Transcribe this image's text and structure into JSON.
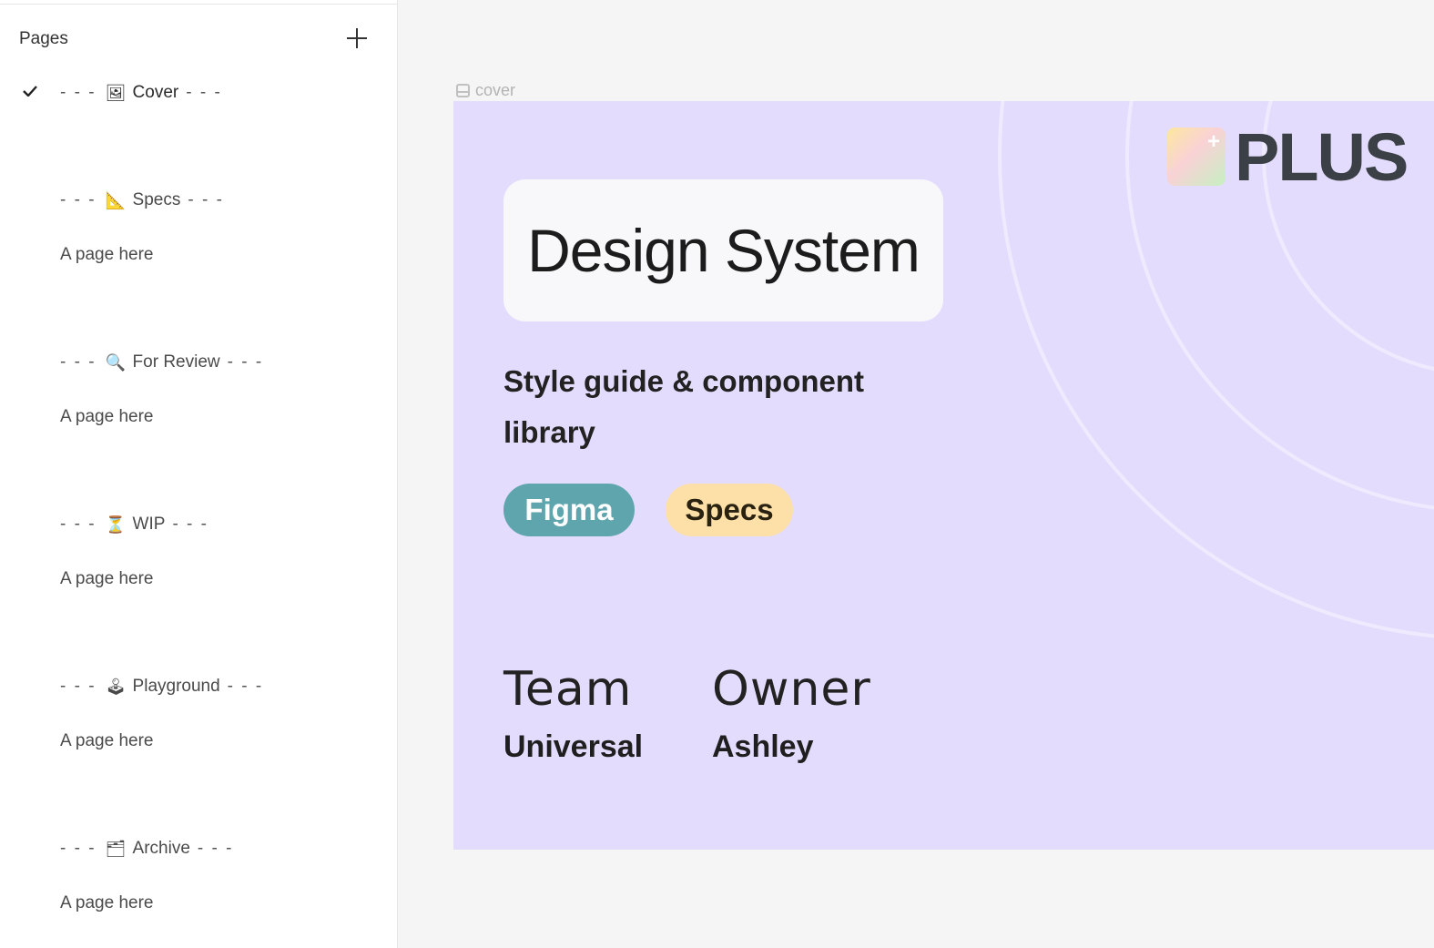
{
  "sidebar": {
    "title": "Pages",
    "add_icon": "plus-icon",
    "items": [
      {
        "label": "Cover",
        "emoji": "🖼",
        "type": "section",
        "current": true
      },
      {
        "label": "Specs",
        "emoji": "📐",
        "type": "section"
      },
      {
        "label": "A page here",
        "type": "page"
      },
      {
        "label": "For Review",
        "emoji": "🔍",
        "type": "section"
      },
      {
        "label": "A page here",
        "type": "page"
      },
      {
        "label": "WIP",
        "emoji": "⏳",
        "type": "section"
      },
      {
        "label": "A page here",
        "type": "page"
      },
      {
        "label": "Playground",
        "emoji": "🕹",
        "type": "section"
      },
      {
        "label": "A page here",
        "type": "page"
      },
      {
        "label": "Archive",
        "emoji": "🗂",
        "type": "section"
      },
      {
        "label": "A page here",
        "type": "page"
      }
    ],
    "dash": "- - -"
  },
  "canvas": {
    "frame_label": "cover",
    "cover": {
      "title": "Design System",
      "subtitle": "Style guide & component library",
      "tags": [
        "Figma",
        "Specs"
      ],
      "team_label": "Team",
      "team_value": "Universal",
      "owner_label": "Owner",
      "owner_value": "Ashley",
      "logo_text": "PLUS",
      "logo_mark_symbol": "+"
    }
  },
  "colors": {
    "cover_bg": "#e4dcfd",
    "figma_tag": "#5fa5ad",
    "specs_tag": "#fddfa8",
    "logo_text": "#3a4046"
  }
}
